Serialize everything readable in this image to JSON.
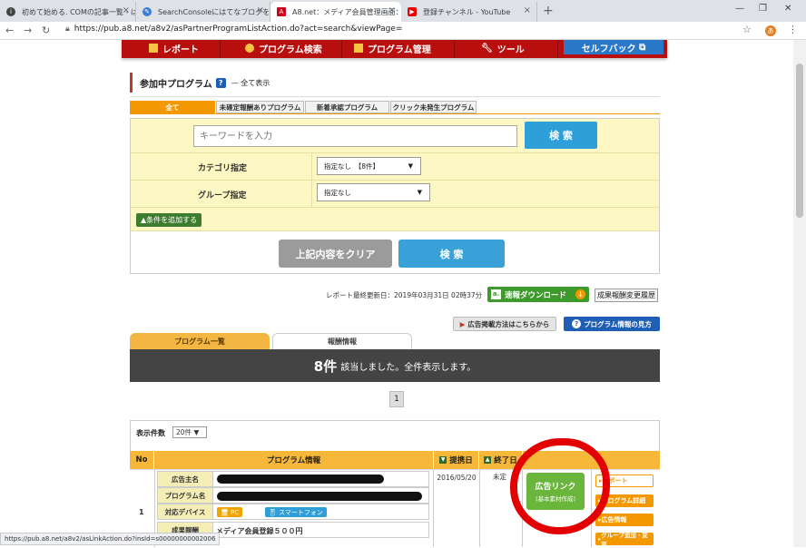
{
  "browser": {
    "tabs": [
      {
        "title": "初めて始める. COMの記事一覧 - は",
        "icon": "info-icon"
      },
      {
        "title": "SearchConsoleにはてなブログを登録",
        "icon": "pen-icon"
      },
      {
        "title": "A8.net：メディア会員管理画面：参",
        "icon": "a8-icon"
      },
      {
        "title": "登録チャンネル - YouTube",
        "icon": "youtube-icon"
      }
    ],
    "url": "https://pub.a8.net/a8v2/asPartnerProgramListAction.do?act=search&viewPage=",
    "profile_initial": "あ",
    "status_url": "https://pub.a8.net/a8v2/asLinkAction.do?insId=s00000000002006"
  },
  "nav": {
    "items": [
      "レポート",
      "プログラム検索",
      "プログラム管理",
      "ツール"
    ],
    "selfback": "セルフバック"
  },
  "heading": {
    "title": "参加中プログラム",
    "help": "?",
    "sub": "— 全て表示"
  },
  "filter_tabs": [
    "全て",
    "未確定報酬ありプログラム",
    "新着承認プログラム",
    "クリック未発生プログラム"
  ],
  "search": {
    "placeholder": "キーワードを入力",
    "search_button": "検 索",
    "category_label": "カテゴリ指定",
    "category_value": "指定なし　【8件】",
    "group_label": "グループ指定",
    "group_value": "指定なし",
    "add_condition": "▲条件を追加する",
    "clear_button": "上記内容をクリア",
    "search_button2": "検 索"
  },
  "report": {
    "updated": "レポート最終更新日：2019年03月31日 02時37分",
    "download": "速報ダウンロード",
    "history": "成果報酬変更履歴",
    "how_to": "広告掲載方法はこちらから",
    "view_guide": "プログラム情報の見方"
  },
  "list_tabs": [
    "プログラム一覧",
    "報酬情報"
  ],
  "result": {
    "count": "8件",
    "text": "該当しました。全件表示します。"
  },
  "pagination": {
    "current": "1"
  },
  "per_page": {
    "label": "表示件数",
    "value": "20件"
  },
  "table": {
    "headers": [
      "No",
      "プログラム情報",
      "提携日",
      "終了日"
    ],
    "row": {
      "no": "1",
      "labels": [
        "広告主名",
        "プログラム名",
        "対応デバイス",
        "成果報酬"
      ],
      "devices": [
        "PC",
        "スマートフォン"
      ],
      "reward": "メディア会員登録５００円",
      "date": "2016/05/20",
      "end": "未定",
      "ad_link": "広告リンク",
      "ad_link_sub": "(基本素材作成)",
      "actions": [
        "レポート",
        "プログラム詳細",
        "広告情報",
        "グループ追加・変更"
      ]
    }
  },
  "colors": {
    "nav_red": "#b80e0e",
    "accent_orange": "#f39800",
    "search_blue": "#2f9fd9",
    "green": "#6ab53b",
    "annotation_red": "#e30000"
  }
}
